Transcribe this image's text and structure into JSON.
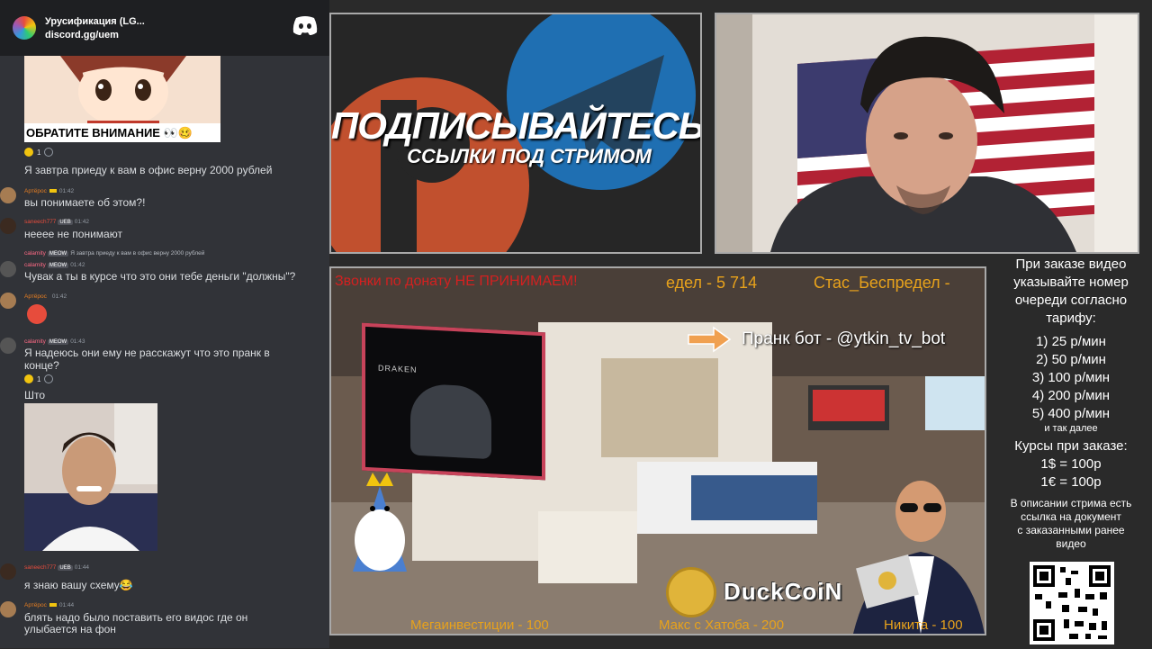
{
  "discord": {
    "server_name": "Урусификация (LG...",
    "server_link": "discord.gg/uem"
  },
  "chat": {
    "img1_caption": "ОБРАТИТЕ ВНИМАНИЕ 👀🥴",
    "reaction1_count": "1",
    "msg1": "Я завтра приеду к вам в офис верну 2000 рублей",
    "m2_user": "Артёрос",
    "m2_time": "01:42",
    "m2_text": "вы понимаете об этом?!",
    "m3_user": "saneech777",
    "m3_tag": "UEB",
    "m3_time": "01:42",
    "m3_text": "неееe не понимают",
    "reply_user": "calamity",
    "reply_tag": "MEOW",
    "reply_text": "Я завтра приеду к вам в офис верну 2000 рублей",
    "m4_user": "calamity",
    "m4_tag": "MEOW",
    "m4_time": "01:42",
    "m4_text": "Чувак а ты в курсе что это они тебе деньги \"должны\"?",
    "m5_user": "Артёрос",
    "m5_time": "01:42",
    "m6_user": "calamity",
    "m6_tag": "MEOW",
    "m6_time": "01:43",
    "m6_text_1": "Я надеюсь они ему не расскажут что это пранк в",
    "m6_text_2": "конце?",
    "reaction2_count": "1",
    "m7_text": "Што",
    "m8_user": "saneech777",
    "m8_tag": "UEB",
    "m8_time": "01:44",
    "m8_text": "я знаю вашу схему😂",
    "m9_user": "Артёрос",
    "m9_time": "01:44",
    "m9_text_1": "блять надо было поставить его видос где он",
    "m9_text_2": "улыбается на фон"
  },
  "promo": {
    "title": "ПОДПИСЫВАЙТЕСЬ",
    "subtitle": "ССЫЛКИ ПОД СТРИМОМ"
  },
  "overlay": {
    "ticker_left": "Звонки по донату НЕ ПРИНИМАЕМ!",
    "ticker_mid": "едел - 5 714",
    "ticker_right": "Стас_Беспредел -",
    "prank_bot": "Пранк бот - @ytkin_tv_bot",
    "bottom_1": "Мегаинвестиции - 100",
    "bottom_2": "Макс с Хатоба - 200",
    "bottom_3": "Никита - 100",
    "duckcoin": "DuckCoiN",
    "laptop_brand": "DRAKEN"
  },
  "donate": {
    "intro": [
      "При заказе видео",
      "указывайте номер",
      "очереди согласно",
      "тарифу:"
    ],
    "tariffs": [
      "1) 25 р/мин",
      "2) 50 р/мин",
      "3) 100 р/мин",
      "4) 200 р/мин",
      "5) 400 р/мин"
    ],
    "etc": "и так далее",
    "rates_title": "Курсы при заказе:",
    "rates": [
      "1$ = 100р",
      "1€ = 100р"
    ],
    "desc": [
      "В описании стрима есть",
      "ссылка на документ",
      "с заказанными ранее",
      "видео"
    ]
  }
}
